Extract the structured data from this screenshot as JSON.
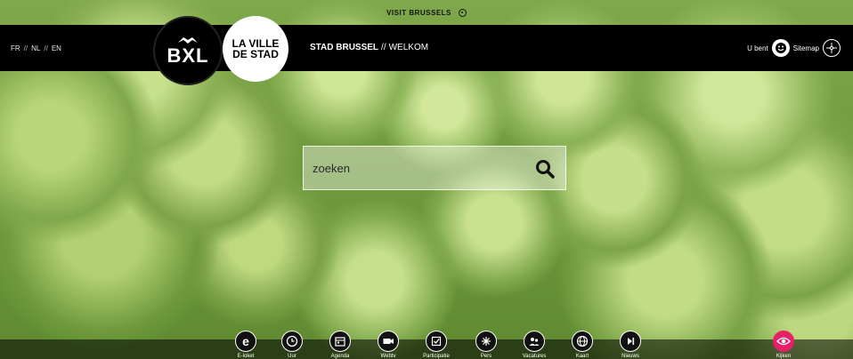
{
  "top_strip": {
    "label": "VISIT BRUSSELS"
  },
  "header": {
    "languages": [
      "FR",
      "NL",
      "EN"
    ],
    "logo_primary": "BXL",
    "logo_secondary": [
      "LA VILLE",
      "DE STAD"
    ],
    "breadcrumb": {
      "site": "STAD BRUSSEL",
      "page": "WELKOM"
    },
    "profile_label": "U bent",
    "sitemap_label": "Sitemap"
  },
  "search": {
    "placeholder": "zoeken"
  },
  "bottom_nav": [
    {
      "label": "E-loket",
      "icon": "e-letter-icon"
    },
    {
      "label": "Uur",
      "icon": "clock-icon"
    },
    {
      "label": "Agenda",
      "icon": "calendar-icon"
    },
    {
      "label": "Webtv",
      "icon": "camera-icon"
    },
    {
      "label": "Participatie",
      "icon": "checkbox-icon"
    },
    {
      "label": "Pers",
      "icon": "sparkle-icon"
    },
    {
      "label": "Vacatures",
      "icon": "people-icon"
    },
    {
      "label": "Kaart",
      "icon": "globe-icon"
    },
    {
      "label": "Nieuws",
      "icon": "play-next-icon"
    },
    {
      "label": "Kijken",
      "icon": "eye-icon",
      "accent": "#e61f68"
    }
  ]
}
